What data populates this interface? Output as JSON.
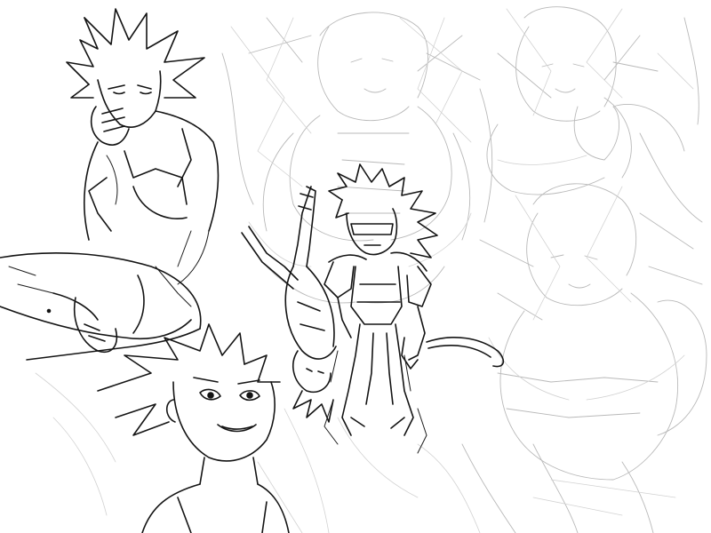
{
  "canvas": {
    "background": "#ffffff",
    "ink_color": "#141414",
    "underdrawing_color": "#b9b9b9"
  },
  "figures": [
    {
      "name": "seated-spiky-hair-figure",
      "style": "finished-lineart"
    },
    {
      "name": "grinning-face-closeup",
      "style": "finished-lineart"
    },
    {
      "name": "kicking-figure",
      "style": "finished-lineart"
    },
    {
      "name": "armored-tailed-figure",
      "style": "finished-lineart"
    },
    {
      "name": "rough-figure-top-center",
      "style": "rough-underdrawing"
    },
    {
      "name": "rough-figure-top-right",
      "style": "rough-underdrawing"
    },
    {
      "name": "rough-figure-bottom-right",
      "style": "rough-underdrawing"
    }
  ]
}
